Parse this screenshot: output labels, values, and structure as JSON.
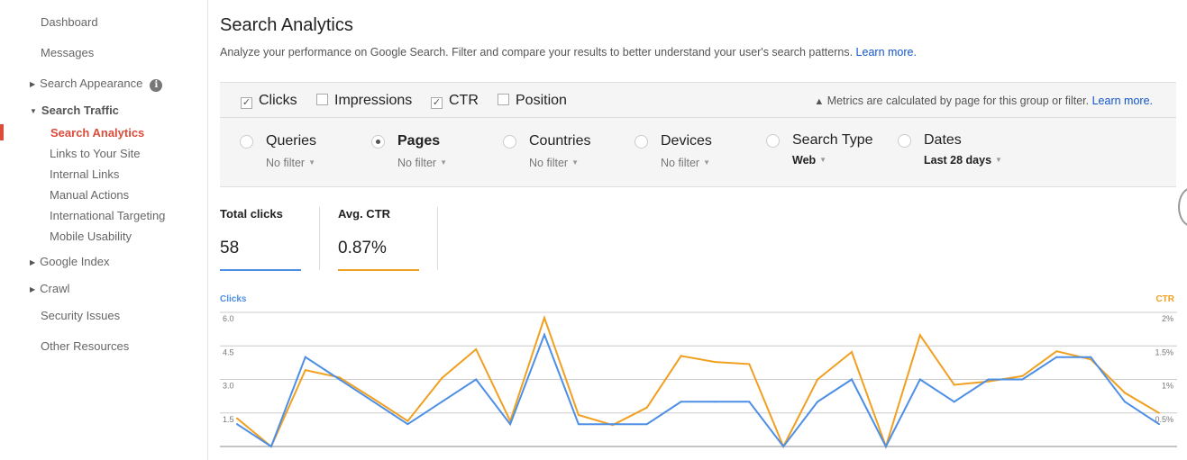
{
  "sidebar": {
    "items": [
      {
        "label": "Dashboard"
      },
      {
        "label": "Messages"
      },
      {
        "label": "Search Appearance",
        "expandable": true,
        "icon": "info-icon"
      },
      {
        "label": "Search Traffic",
        "expanded": true
      },
      {
        "label": "Google Index",
        "expandable": true
      },
      {
        "label": "Crawl",
        "expandable": true
      },
      {
        "label": "Security Issues"
      },
      {
        "label": "Other Resources"
      }
    ],
    "subitems": [
      {
        "label": "Search Analytics",
        "active": true
      },
      {
        "label": "Links to Your Site"
      },
      {
        "label": "Internal Links"
      },
      {
        "label": "Manual Actions"
      },
      {
        "label": "International Targeting"
      },
      {
        "label": "Mobile Usability"
      }
    ],
    "accent": "#dd4b39"
  },
  "header": {
    "title": "Search Analytics",
    "description": "Analyze your performance on Google Search. Filter and compare your results to better understand your user's search patterns.",
    "learn_more": "Learn more."
  },
  "metrics": [
    {
      "label": "Clicks",
      "checked": true
    },
    {
      "label": "Impressions",
      "checked": false
    },
    {
      "label": "CTR",
      "checked": true
    },
    {
      "label": "Position",
      "checked": false
    }
  ],
  "metrics_note": {
    "text": "Metrics are calculated by page for this group or filter.",
    "link": "Learn more."
  },
  "dimensions": [
    {
      "label": "Queries",
      "filter": "No filter",
      "selected": false
    },
    {
      "label": "Pages",
      "filter": "No filter",
      "selected": true
    },
    {
      "label": "Countries",
      "filter": "No filter",
      "selected": false
    },
    {
      "label": "Devices",
      "filter": "No filter",
      "selected": false
    },
    {
      "label": "Search Type",
      "filter": "Web",
      "selected": false
    },
    {
      "label": "Dates",
      "filter": "Last 28 days",
      "selected": false
    }
  ],
  "totals": [
    {
      "label": "Total clicks",
      "value": "58",
      "color": "#4d8fe6"
    },
    {
      "label": "Avg. CTR",
      "value": "0.87%",
      "color": "#f0a020"
    }
  ],
  "chart_data": {
    "type": "line",
    "left_axis": {
      "label": "Clicks",
      "ticks": [
        "1.5",
        "3.0",
        "4.5",
        "6.0"
      ],
      "range": [
        0,
        6
      ]
    },
    "right_axis": {
      "label": "CTR",
      "ticks": [
        "0.5%",
        "1%",
        "1.5%",
        "2%"
      ],
      "range": [
        0,
        2
      ]
    },
    "grid": true,
    "series": [
      {
        "name": "Clicks",
        "axis": "left",
        "color": "#4d8fe6",
        "values": [
          1,
          0,
          4,
          3,
          2,
          1,
          2,
          3,
          1,
          5,
          1,
          1,
          1,
          2,
          2,
          2,
          0,
          2,
          3,
          0,
          3,
          2,
          3,
          3,
          4,
          4,
          2,
          1
        ]
      },
      {
        "name": "CTR",
        "axis": "right",
        "color": "#f0a020",
        "values": [
          0.42,
          0,
          1.14,
          1.03,
          0.71,
          0.38,
          1.02,
          1.45,
          0.38,
          1.92,
          0.47,
          0.32,
          0.58,
          1.35,
          1.26,
          1.23,
          0,
          1.0,
          1.41,
          0,
          1.66,
          0.92,
          0.97,
          1.05,
          1.42,
          1.3,
          0.8,
          0.5
        ]
      }
    ]
  }
}
